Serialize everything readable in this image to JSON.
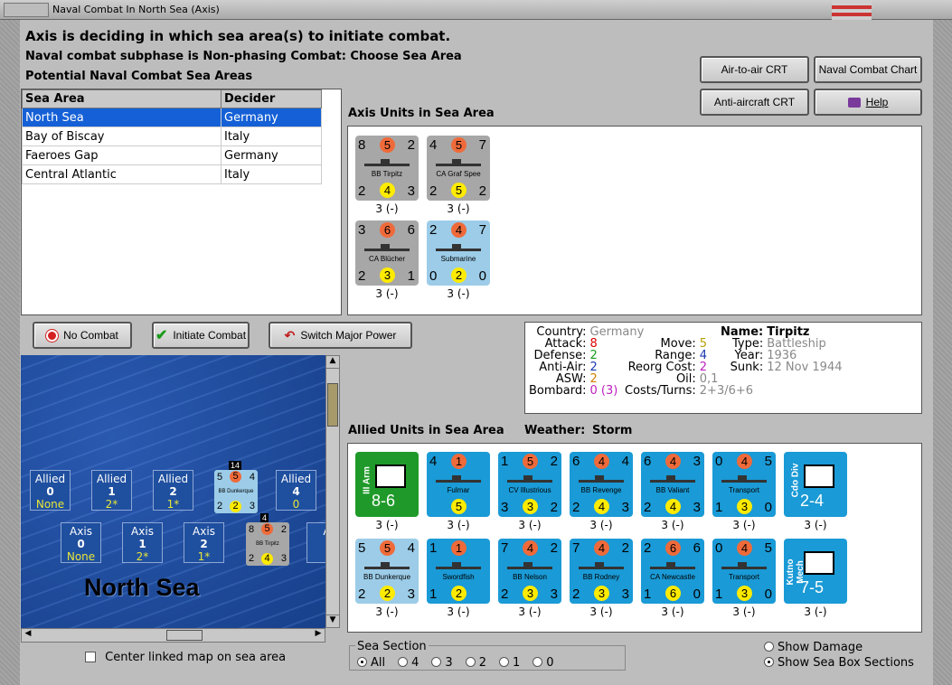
{
  "window": {
    "title": "Naval Combat In North Sea (Axis)"
  },
  "header": {
    "line1": "Axis is deciding in which sea area(s) to initiate combat.",
    "line2": "Naval combat subphase is Non-phasing Combat: Choose Sea Area",
    "line3": "Potential Naval Combat Sea Areas"
  },
  "buttons": {
    "air_crt": "Air-to-air CRT",
    "naval_chart": "Naval Combat Chart",
    "aa_crt": "Anti-aircraft CRT",
    "help": "Help",
    "no_combat": "No Combat",
    "initiate": "Initiate Combat",
    "switch": "Switch Major Power"
  },
  "sea_table": {
    "headers": [
      "Sea Area",
      "Decider"
    ],
    "rows": [
      {
        "area": "North Sea",
        "decider": "Germany"
      },
      {
        "area": "Bay of Biscay",
        "decider": "Italy"
      },
      {
        "area": "Faeroes Gap",
        "decider": "Germany"
      },
      {
        "area": "Central Atlantic",
        "decider": "Italy"
      }
    ]
  },
  "axis_units": {
    "title": "Axis Units in Sea Area",
    "units": [
      {
        "a": "8",
        "m": "5",
        "r": "2",
        "name": "BB Tirpitz",
        "d": "2",
        "aa": "4",
        "s": "3",
        "cap": "3 (-)"
      },
      {
        "a": "4",
        "m": "5",
        "r": "7",
        "name": "CA Graf Spee",
        "d": "2",
        "aa": "5",
        "s": "2",
        "cap": "3 (-)"
      },
      {
        "a": "3",
        "m": "6",
        "r": "6",
        "name": "CA Blücher",
        "d": "2",
        "aa": "3",
        "s": "1",
        "cap": "3 (-)"
      },
      {
        "a": "2",
        "m": "4",
        "r": "7",
        "name": "Submarine",
        "d": "0",
        "aa": "2",
        "s": "0",
        "cap": "3 (-)"
      }
    ]
  },
  "info": {
    "country_label": "Country:",
    "country": "Germany",
    "attack_label": "Attack:",
    "attack": "8",
    "defense_label": "Defense:",
    "defense": "2",
    "aa_label": "Anti-Air:",
    "aa": "2",
    "asw_label": "ASW:",
    "asw": "2",
    "bombard_label": "Bombard:",
    "bombard": "0 (3)",
    "name_label": "Name:",
    "name": "Tirpitz",
    "type_label": "Type:",
    "type": "Battleship",
    "year_label": "Year:",
    "year": "1936",
    "sunk_label": "Sunk:",
    "sunk": "12 Nov 1944",
    "move_label": "Move:",
    "move": "5",
    "range_label": "Range:",
    "range": "4",
    "reorg_label": "Reorg Cost:",
    "reorg": "2",
    "oil_label": "Oil:",
    "oil": "0,1",
    "costs_label": "Costs/Turns:",
    "costs": "2+3/6+6"
  },
  "allied": {
    "title": "Allied Units in Sea Area",
    "weather_label": "Weather:",
    "weather": "Storm",
    "row1": [
      {
        "top": "III Arm",
        "big": "8-6",
        "kind": "army",
        "cap": "3 (-)"
      },
      {
        "a": "4",
        "m": "1",
        "r": "",
        "name": "Fulmar",
        "d": "",
        "aa": "5",
        "s": "",
        "cap": "3 (-)"
      },
      {
        "a": "1",
        "m": "5",
        "r": "2",
        "name": "CV Illustrious",
        "d": "3",
        "aa": "3",
        "s": "2",
        "cap": "3 (-)"
      },
      {
        "a": "6",
        "m": "4",
        "r": "4",
        "name": "BB Revenge",
        "d": "2",
        "aa": "4",
        "s": "3",
        "cap": "3 (-)"
      },
      {
        "a": "6",
        "m": "4",
        "r": "3",
        "name": "BB Valiant",
        "d": "2",
        "aa": "4",
        "s": "3",
        "cap": "3 (-)"
      },
      {
        "a": "0",
        "m": "4",
        "r": "5",
        "name": "Transport",
        "d": "1",
        "aa": "3",
        "s": "0",
        "cap": "3 (-)"
      },
      {
        "top": "Cdo Div",
        "big": "2-4",
        "kind": "inf",
        "cap": "3 (-)"
      }
    ],
    "row2": [
      {
        "a": "5",
        "m": "5",
        "r": "4",
        "name": "BB Dunkerque",
        "d": "2",
        "aa": "2",
        "s": "3",
        "cap": "3 (-)"
      },
      {
        "a": "1",
        "m": "1",
        "r": "",
        "name": "Swordfish",
        "d": "1",
        "aa": "2",
        "s": "",
        "cap": "3 (-)"
      },
      {
        "a": "7",
        "m": "4",
        "r": "2",
        "name": "BB Nelson",
        "d": "2",
        "aa": "3",
        "s": "3",
        "cap": "3 (-)"
      },
      {
        "a": "7",
        "m": "4",
        "r": "2",
        "name": "BB Rodney",
        "d": "2",
        "aa": "3",
        "s": "3",
        "cap": "3 (-)"
      },
      {
        "a": "2",
        "m": "6",
        "r": "6",
        "name": "CA Newcastle",
        "d": "1",
        "aa": "6",
        "s": "0",
        "cap": "3 (-)"
      },
      {
        "a": "0",
        "m": "4",
        "r": "5",
        "name": "Transport",
        "d": "1",
        "aa": "3",
        "s": "0",
        "cap": "3 (-)"
      },
      {
        "top": "Kutno Mech",
        "big": "7-5",
        "kind": "mech",
        "cap": "3 (-)"
      }
    ]
  },
  "map": {
    "title": "North Sea",
    "allied_boxes": [
      {
        "l": "Allied",
        "n": "0",
        "s": "None"
      },
      {
        "l": "Allied",
        "n": "1",
        "s": "2*"
      },
      {
        "l": "Allied",
        "n": "2",
        "s": "1*"
      },
      {
        "l": "Allied",
        "n": "4",
        "s": "0"
      }
    ],
    "axis_boxes": [
      {
        "l": "Axis",
        "n": "0",
        "s": "None"
      },
      {
        "l": "Axis",
        "n": "1",
        "s": "2*"
      },
      {
        "l": "Axis",
        "n": "2",
        "s": "1*"
      },
      {
        "l": "A"
      }
    ],
    "stack1": {
      "count": "14",
      "a": "5",
      "m": "5",
      "r": "4",
      "name": "BB Dunkerque",
      "d": "2",
      "aa": "2",
      "s": "3"
    },
    "stack2": {
      "count": "4",
      "a": "8",
      "m": "5",
      "r": "2",
      "name": "BB Tirpitz",
      "d": "2",
      "aa": "4",
      "s": "3"
    }
  },
  "center_link": "Center linked map on sea area",
  "sea_section": {
    "label": "Sea Section",
    "options": [
      "All",
      "4",
      "3",
      "2",
      "1",
      "0"
    ],
    "selected": "All"
  },
  "show_damage": "Show Damage",
  "show_sections": "Show Sea Box Sections"
}
